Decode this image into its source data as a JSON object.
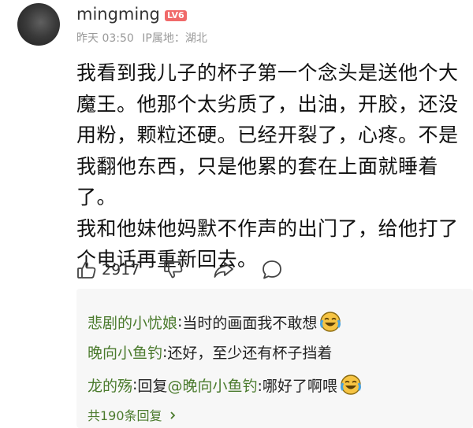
{
  "post": {
    "username": "mingming",
    "level": "LV6",
    "time": "昨天 03:50",
    "ip_location": "IP属地：湖北",
    "comment_lines": [
      "我看到我儿子的杯子第一个念头是送他个大",
      "魔王。他那个太劣质了，出油，开胶，还没",
      "用粉，颗粒还硬。已经开裂了，心疼。不是",
      "我翻他东西，只是他累的套在上面就睡着了。",
      "我和他妹他妈默不作声的出门了，给他打了",
      "个电话再重新回去。"
    ],
    "likes": "2917"
  },
  "replies": [
    {
      "name": "悲剧的小忧娘",
      "sep": ": ",
      "text": "当时的画面我不敢想",
      "emoji": "laugh-cry-emoji"
    },
    {
      "name": "晚向小鱼钓",
      "sep": ": ",
      "text": "还好，至少还有杯子挡着"
    },
    {
      "name": "龙的殇",
      "sep": ": ",
      "prefix": "回复 ",
      "mention": "@晚向小鱼钓",
      "text": " :哪好了啊喂",
      "emoji": "laugh-cry-emoji"
    }
  ],
  "more_replies": "共190条回复",
  "icons": [
    "thumbs-up-icon",
    "thumbs-down-icon",
    "share-icon",
    "comment-icon",
    "chevron-right-icon"
  ],
  "colors": {
    "name_green": "#4a7a2c",
    "level_badge": "#f06a6a",
    "meta_gray": "#9a9a9a"
  }
}
